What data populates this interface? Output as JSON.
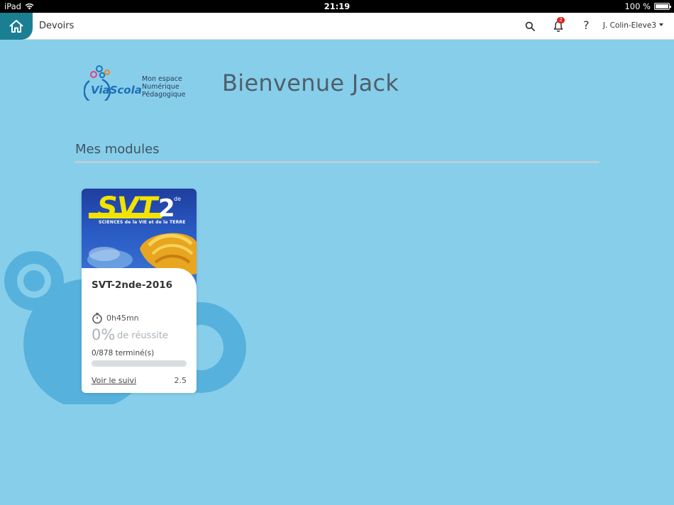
{
  "status_bar": {
    "device": "iPad",
    "time": "21:19",
    "battery": "100 %"
  },
  "nav": {
    "title": "Devoirs",
    "notifications_count": "2",
    "help_label": "?",
    "user": "J. Colin-Eleve3"
  },
  "logo": {
    "word": "ViaScola",
    "tagline_1": "Mon espace",
    "tagline_2": "Numérique",
    "tagline_3": "Pédagogique"
  },
  "welcome": "Bienvenue Jack",
  "section_title": "Mes modules",
  "modules": [
    {
      "cover": {
        "title": "SVT",
        "grade": "2",
        "grade_suffix": "de",
        "subtitle": "SCIENCES de la VIE et de la TERRE"
      },
      "name": "SVT-2nde-2016",
      "duration": "0h45mn",
      "success_pct": "0%",
      "success_label": "de réussite",
      "completed": "0/878 terminé(s)",
      "progress": 0,
      "link": "Voir le suivi",
      "version": "2.5"
    }
  ],
  "colors": {
    "background": "#87ceea",
    "accent": "#1b7f94",
    "badge": "#dd2222"
  }
}
